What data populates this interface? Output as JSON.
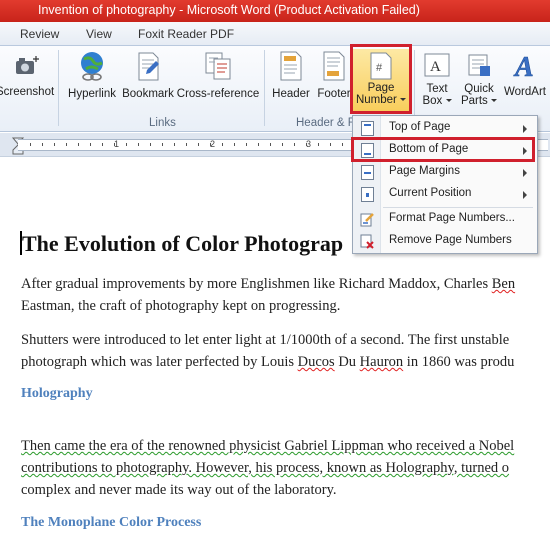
{
  "titlebar": {
    "title": "Invention of photography  -  Microsoft Word (Product Activation Failed)"
  },
  "tabs": [
    "Review",
    "View",
    "Foxit Reader PDF"
  ],
  "ribbon": {
    "screenshot": "Screenshot",
    "hyperlink": "Hyperlink",
    "bookmark": "Bookmark",
    "cross_reference": "Cross-reference",
    "links_group": "Links",
    "header": "Header",
    "footer": "Footer",
    "page_number_l1": "Page",
    "page_number_l2": "Number",
    "header_footer_group": "Header & F",
    "text_box_l1": "Text",
    "text_box_l2": "Box",
    "quick_parts_l1": "Quick",
    "quick_parts_l2": "Parts",
    "wordart": "WordArt"
  },
  "ruler": {
    "numbers": [
      "1",
      "2",
      "3"
    ]
  },
  "menu": {
    "items": [
      "Top of Page",
      "Bottom of Page",
      "Page Margins",
      "Current Position",
      "Format Page Numbers...",
      "Remove Page Numbers"
    ]
  },
  "document": {
    "heading": "The Evolution of Color Photograp",
    "p1_line1_a": " After gradual improvements by more  Englishmen like Richard Maddox, Charles ",
    "p1_line1_b": "Ben",
    "p1_line2": "Eastman, the craft of photography  kept on progressing.",
    "p2_line1": "Shutters were introduced to let enter light at 1/1000th of a second. The first unstable",
    "p2_line2_a": "photograph  which was later perfected by Louis ",
    "p2_line2_b": "Ducos",
    "p2_line2_c": " Du ",
    "p2_line2_d": "Hauron",
    "p2_line2_e": " in 1860 was produ",
    "h_holography": "Holography",
    "p3_line1": "Then came the era of the renowned physicist Gabriel Lippman who received a Nobel",
    "p3_line2": "contributions to photography. However, his process, known as Holography, turned o",
    "p3_line3": "complex and never made its way out of the laboratory.",
    "h_monoplane": "The Monoplane Color Process"
  }
}
